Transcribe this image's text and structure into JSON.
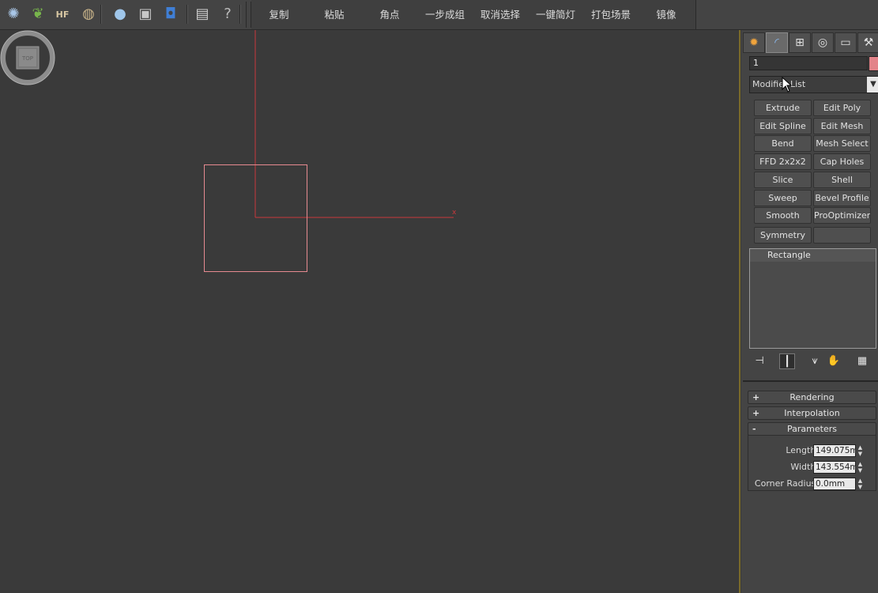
{
  "toolbar": {
    "icons": [
      {
        "name": "gear-plugin-icon",
        "glyph": "✺",
        "color": "#a9c6e6"
      },
      {
        "name": "grass-plugin-icon",
        "glyph": "❦",
        "color": "#78b64c"
      },
      {
        "name": "hair-fur-icon",
        "glyph": "HF",
        "color": "#d8c7a3"
      },
      {
        "name": "ornatrix-icon",
        "glyph": "◍",
        "color": "#c9b48a"
      },
      {
        "name": "material-sphere-icon",
        "glyph": "●",
        "color": "#9fc6ea"
      },
      {
        "name": "render-setup-icon",
        "glyph": "▣",
        "color": "#c8c8c8"
      },
      {
        "name": "render-region-icon",
        "glyph": "◘",
        "color": "#3f7fd6"
      },
      {
        "name": "clipboard-icon",
        "glyph": "▤",
        "color": "#cfcfcf"
      },
      {
        "name": "help-icon",
        "glyph": "?",
        "color": "#bdbdbd"
      }
    ],
    "quick_buttons": [
      "复制",
      "粘贴",
      "角点",
      "一步成组",
      "取消选择",
      "一键简灯",
      "打包场景",
      "镜像"
    ]
  },
  "viewport": {
    "axis_color": "#c8383c",
    "shape_color": "#e68a90",
    "axis_x_label": "x",
    "viewcube_label": "TOP"
  },
  "panel": {
    "tabs": [
      "create-tab",
      "modify-tab",
      "hierarchy-tab",
      "motion-tab",
      "display-tab",
      "utilities-tab"
    ],
    "object_name": "1",
    "object_color": "#e3848a",
    "modifier_list": "Modifier List",
    "modifier_buttons": [
      [
        "Extrude",
        "Edit Poly"
      ],
      [
        "Edit Spline",
        "Edit Mesh"
      ],
      [
        "Bend",
        "Mesh Select"
      ],
      [
        "FFD 2x2x2",
        "Cap Holes"
      ],
      [
        "Slice",
        "Shell"
      ],
      [
        "Sweep",
        "Bevel Profile"
      ],
      [
        "Smooth",
        "ProOptimizer"
      ],
      [
        "Symmetry",
        ""
      ]
    ],
    "stack": [
      "Rectangle"
    ],
    "rollouts": [
      {
        "sign": "+",
        "title": "Rendering"
      },
      {
        "sign": "+",
        "title": "Interpolation"
      },
      {
        "sign": "-",
        "title": "Parameters"
      }
    ],
    "params": [
      {
        "label": "Length:",
        "value": "149.075m"
      },
      {
        "label": "Width:",
        "value": "143.554m"
      },
      {
        "label": "Corner Radius:",
        "value": "0.0mm"
      }
    ]
  }
}
